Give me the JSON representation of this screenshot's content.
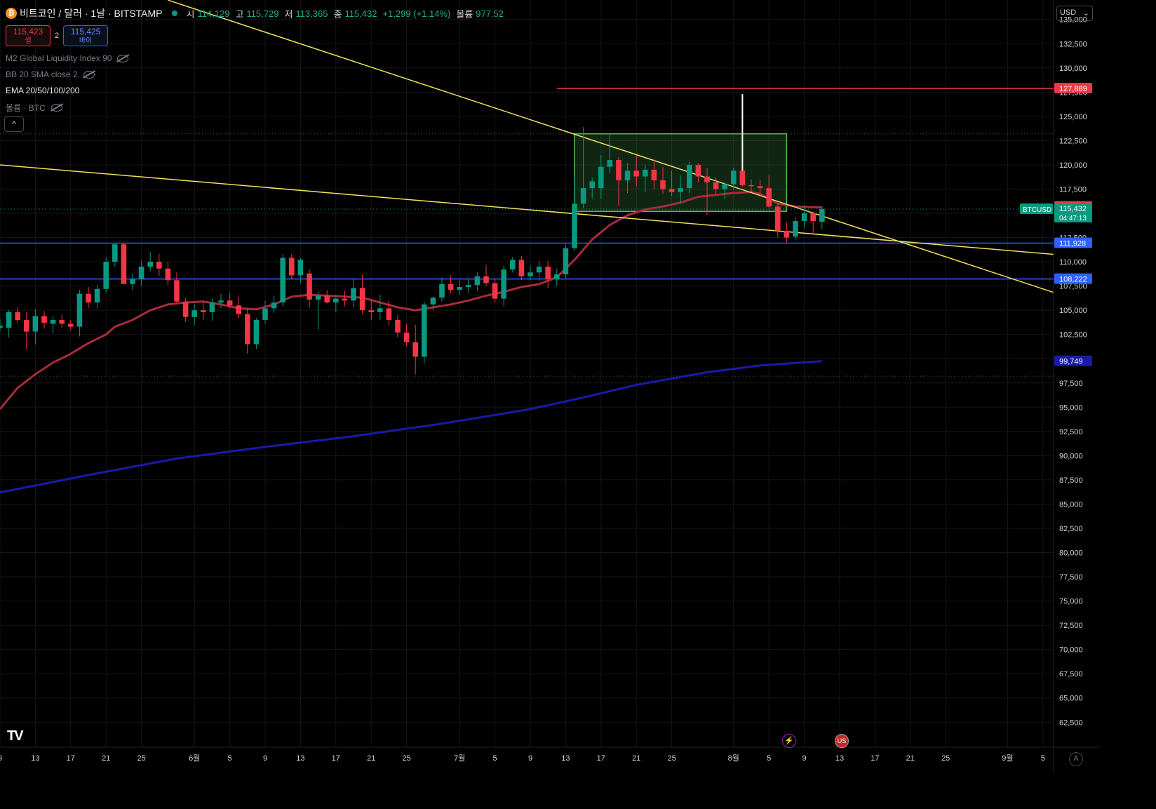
{
  "header": {
    "symbol_icon": "bitcoin-icon",
    "title": "비트코인 / 달러 · 1날 · BITSTAMP",
    "open_label": "시",
    "open": "114,129",
    "high_label": "고",
    "high": "115,729",
    "low_label": "저",
    "low": "113,365",
    "close_label": "종",
    "close": "115,432",
    "change": "+1,299 (+1.14%)",
    "volume_label": "볼륨",
    "volume": "977.52"
  },
  "trade": {
    "sell_price": "115,423",
    "sell_label": "셀",
    "spread": "2",
    "buy_price": "115,425",
    "buy_label": "바이"
  },
  "indicators": [
    {
      "label": "M2 Global Liquidity Index 90",
      "hidden": true
    },
    {
      "label": "BB 20 SMA close 2",
      "hidden": true
    },
    {
      "label": "EMA 20/50/100/200",
      "hidden": false
    },
    {
      "label": "볼륨 · BTC",
      "hidden": true
    }
  ],
  "currency": "USD",
  "collapse_glyph": "^",
  "logo_text": "TV",
  "events": [
    {
      "icon": "lightning-icon",
      "glyph": "⚡"
    },
    {
      "icon": "us-flag-icon",
      "glyph": "US"
    }
  ],
  "auto_label": "A",
  "colors": {
    "bg": "#000000",
    "up": "#089981",
    "down": "#f23645",
    "ema20": "#a82b3a",
    "ema200": "#1a1aa8",
    "trend": "#f2e05c",
    "support": "#2962ff",
    "resistance": "#f23645",
    "range_box": "#5bb85b"
  },
  "chart_data": {
    "type": "candlestick",
    "y_range": [
      61000,
      136500
    ],
    "y_ticks": [
      62500,
      65000,
      67500,
      70000,
      72500,
      75000,
      77500,
      80000,
      82500,
      85000,
      87500,
      90000,
      92500,
      95000,
      97500,
      100000,
      102500,
      105000,
      107500,
      110000,
      112500,
      115000,
      117500,
      120000,
      122500,
      125000,
      127500,
      130000,
      132500,
      135000
    ],
    "x_ticks": [
      {
        "day": 0,
        "label": "9"
      },
      {
        "day": 4,
        "label": "13"
      },
      {
        "day": 8,
        "label": "17"
      },
      {
        "day": 12,
        "label": "21"
      },
      {
        "day": 16,
        "label": "25"
      },
      {
        "day": 22,
        "label": "6월"
      },
      {
        "day": 26,
        "label": "5"
      },
      {
        "day": 30,
        "label": "9"
      },
      {
        "day": 34,
        "label": "13"
      },
      {
        "day": 38,
        "label": "17"
      },
      {
        "day": 42,
        "label": "21"
      },
      {
        "day": 46,
        "label": "25"
      },
      {
        "day": 52,
        "label": "7월"
      },
      {
        "day": 56,
        "label": "5"
      },
      {
        "day": 60,
        "label": "9"
      },
      {
        "day": 64,
        "label": "13"
      },
      {
        "day": 68,
        "label": "17"
      },
      {
        "day": 72,
        "label": "21"
      },
      {
        "day": 76,
        "label": "25"
      },
      {
        "day": 83,
        "label": "8월"
      },
      {
        "day": 87,
        "label": "5"
      },
      {
        "day": 91,
        "label": "9"
      },
      {
        "day": 95,
        "label": "13"
      },
      {
        "day": 99,
        "label": "17"
      },
      {
        "day": 103,
        "label": "21"
      },
      {
        "day": 107,
        "label": "25"
      },
      {
        "day": 114,
        "label": "9월"
      },
      {
        "day": 118,
        "label": "5"
      }
    ],
    "candles": [
      {
        "day": 0,
        "o": 103200,
        "h": 104100,
        "l": 102800,
        "c": 103400
      },
      {
        "day": 1,
        "o": 103200,
        "h": 105000,
        "l": 102200,
        "c": 104800
      },
      {
        "day": 2,
        "o": 104800,
        "h": 105300,
        "l": 103700,
        "c": 104000
      },
      {
        "day": 3,
        "o": 104000,
        "h": 104800,
        "l": 101000,
        "c": 102800
      },
      {
        "day": 4,
        "o": 102800,
        "h": 105100,
        "l": 101500,
        "c": 104400
      },
      {
        "day": 5,
        "o": 104400,
        "h": 104900,
        "l": 103100,
        "c": 103700
      },
      {
        "day": 6,
        "o": 103600,
        "h": 104400,
        "l": 102600,
        "c": 104000
      },
      {
        "day": 7,
        "o": 104000,
        "h": 104500,
        "l": 103200,
        "c": 103600
      },
      {
        "day": 8,
        "o": 103600,
        "h": 104000,
        "l": 102900,
        "c": 103300
      },
      {
        "day": 9,
        "o": 103300,
        "h": 107100,
        "l": 102300,
        "c": 106700
      },
      {
        "day": 10,
        "o": 106700,
        "h": 107400,
        "l": 105200,
        "c": 105800
      },
      {
        "day": 11,
        "o": 105800,
        "h": 107600,
        "l": 105200,
        "c": 107200
      },
      {
        "day": 12,
        "o": 107200,
        "h": 110500,
        "l": 106800,
        "c": 110000
      },
      {
        "day": 13,
        "o": 110000,
        "h": 112000,
        "l": 109500,
        "c": 111800
      },
      {
        "day": 14,
        "o": 111800,
        "h": 112000,
        "l": 108000,
        "c": 107700
      },
      {
        "day": 15,
        "o": 107700,
        "h": 108800,
        "l": 107100,
        "c": 108200
      },
      {
        "day": 16,
        "o": 108200,
        "h": 110100,
        "l": 107500,
        "c": 109500
      },
      {
        "day": 17,
        "o": 109500,
        "h": 111000,
        "l": 109000,
        "c": 110000
      },
      {
        "day": 18,
        "o": 110000,
        "h": 110800,
        "l": 108500,
        "c": 109300
      },
      {
        "day": 19,
        "o": 109300,
        "h": 110000,
        "l": 107600,
        "c": 108100
      },
      {
        "day": 20,
        "o": 108100,
        "h": 108900,
        "l": 105800,
        "c": 105900
      },
      {
        "day": 21,
        "o": 105900,
        "h": 106300,
        "l": 103800,
        "c": 104300
      },
      {
        "day": 22,
        "o": 104300,
        "h": 105700,
        "l": 103500,
        "c": 105000
      },
      {
        "day": 23,
        "o": 105000,
        "h": 105900,
        "l": 104000,
        "c": 104800
      },
      {
        "day": 24,
        "o": 104800,
        "h": 106200,
        "l": 103900,
        "c": 105800
      },
      {
        "day": 25,
        "o": 105800,
        "h": 106700,
        "l": 105200,
        "c": 106000
      },
      {
        "day": 26,
        "o": 106000,
        "h": 106800,
        "l": 105200,
        "c": 105500
      },
      {
        "day": 27,
        "o": 105500,
        "h": 106400,
        "l": 104200,
        "c": 104600
      },
      {
        "day": 28,
        "o": 104600,
        "h": 105200,
        "l": 100500,
        "c": 101500
      },
      {
        "day": 29,
        "o": 101500,
        "h": 104200,
        "l": 101000,
        "c": 104000
      },
      {
        "day": 30,
        "o": 104000,
        "h": 106000,
        "l": 103600,
        "c": 105200
      },
      {
        "day": 31,
        "o": 105200,
        "h": 106500,
        "l": 104700,
        "c": 105800
      },
      {
        "day": 32,
        "o": 105800,
        "h": 110800,
        "l": 105400,
        "c": 110400
      },
      {
        "day": 33,
        "o": 110400,
        "h": 110800,
        "l": 108200,
        "c": 108600
      },
      {
        "day": 34,
        "o": 108600,
        "h": 110400,
        "l": 107800,
        "c": 110200
      },
      {
        "day": 35,
        "o": 108800,
        "h": 109200,
        "l": 105200,
        "c": 106100
      },
      {
        "day": 36,
        "o": 106100,
        "h": 106900,
        "l": 103000,
        "c": 106500
      },
      {
        "day": 37,
        "o": 106500,
        "h": 107100,
        "l": 105700,
        "c": 105800
      },
      {
        "day": 38,
        "o": 105800,
        "h": 106600,
        "l": 104800,
        "c": 106200
      },
      {
        "day": 39,
        "o": 106200,
        "h": 107000,
        "l": 105400,
        "c": 106000
      },
      {
        "day": 40,
        "o": 106000,
        "h": 108200,
        "l": 105300,
        "c": 107300
      },
      {
        "day": 41,
        "o": 107300,
        "h": 108700,
        "l": 104600,
        "c": 105000
      },
      {
        "day": 42,
        "o": 105000,
        "h": 106100,
        "l": 104000,
        "c": 104800
      },
      {
        "day": 43,
        "o": 104800,
        "h": 106600,
        "l": 104000,
        "c": 105200
      },
      {
        "day": 44,
        "o": 105200,
        "h": 106000,
        "l": 103400,
        "c": 104000
      },
      {
        "day": 45,
        "o": 104000,
        "h": 104500,
        "l": 102200,
        "c": 102700
      },
      {
        "day": 46,
        "o": 102700,
        "h": 103600,
        "l": 101300,
        "c": 101700
      },
      {
        "day": 47,
        "o": 101700,
        "h": 103500,
        "l": 98400,
        "c": 100200
      },
      {
        "day": 48,
        "o": 100200,
        "h": 105900,
        "l": 99500,
        "c": 105600
      },
      {
        "day": 49,
        "o": 105600,
        "h": 106400,
        "l": 105000,
        "c": 106300
      },
      {
        "day": 50,
        "o": 106300,
        "h": 108400,
        "l": 105900,
        "c": 107700
      },
      {
        "day": 51,
        "o": 107700,
        "h": 108600,
        "l": 106800,
        "c": 107100
      },
      {
        "day": 52,
        "o": 107100,
        "h": 108100,
        "l": 106600,
        "c": 107400
      },
      {
        "day": 53,
        "o": 107400,
        "h": 108200,
        "l": 106800,
        "c": 107600
      },
      {
        "day": 54,
        "o": 107600,
        "h": 108900,
        "l": 107000,
        "c": 108500
      },
      {
        "day": 55,
        "o": 108500,
        "h": 109700,
        "l": 107500,
        "c": 107800
      },
      {
        "day": 56,
        "o": 107800,
        "h": 108200,
        "l": 105800,
        "c": 106200
      },
      {
        "day": 57,
        "o": 106200,
        "h": 109600,
        "l": 105400,
        "c": 109200
      },
      {
        "day": 58,
        "o": 109200,
        "h": 110500,
        "l": 108900,
        "c": 110200
      },
      {
        "day": 59,
        "o": 110200,
        "h": 110600,
        "l": 108100,
        "c": 108500
      },
      {
        "day": 60,
        "o": 108500,
        "h": 109600,
        "l": 108100,
        "c": 108900
      },
      {
        "day": 61,
        "o": 108900,
        "h": 110100,
        "l": 108000,
        "c": 109500
      },
      {
        "day": 62,
        "o": 109500,
        "h": 110100,
        "l": 107300,
        "c": 108200
      },
      {
        "day": 63,
        "o": 108200,
        "h": 109300,
        "l": 107500,
        "c": 108700
      },
      {
        "day": 64,
        "o": 108700,
        "h": 111800,
        "l": 108300,
        "c": 111400
      },
      {
        "day": 65,
        "o": 111400,
        "h": 118800,
        "l": 111100,
        "c": 116000
      },
      {
        "day": 66,
        "o": 116000,
        "h": 123900,
        "l": 115500,
        "c": 117600
      },
      {
        "day": 67,
        "o": 117600,
        "h": 118700,
        "l": 116500,
        "c": 118300
      },
      {
        "day": 68,
        "o": 117600,
        "h": 121000,
        "l": 116500,
        "c": 119800
      },
      {
        "day": 69,
        "o": 119800,
        "h": 123200,
        "l": 119100,
        "c": 120500
      },
      {
        "day": 70,
        "o": 120500,
        "h": 120800,
        "l": 115800,
        "c": 118400
      },
      {
        "day": 71,
        "o": 118400,
        "h": 120200,
        "l": 117100,
        "c": 119400
      },
      {
        "day": 72,
        "o": 119400,
        "h": 121000,
        "l": 117800,
        "c": 118800
      },
      {
        "day": 73,
        "o": 118800,
        "h": 120000,
        "l": 117200,
        "c": 119500
      },
      {
        "day": 74,
        "o": 119500,
        "h": 120600,
        "l": 117500,
        "c": 118400
      },
      {
        "day": 75,
        "o": 118400,
        "h": 119800,
        "l": 117000,
        "c": 117500
      },
      {
        "day": 76,
        "o": 117500,
        "h": 119400,
        "l": 116800,
        "c": 117200
      },
      {
        "day": 77,
        "o": 117200,
        "h": 118900,
        "l": 116000,
        "c": 117600
      },
      {
        "day": 78,
        "o": 117600,
        "h": 120300,
        "l": 117000,
        "c": 120000
      },
      {
        "day": 79,
        "o": 120000,
        "h": 120200,
        "l": 118200,
        "c": 118800
      },
      {
        "day": 80,
        "o": 118800,
        "h": 119700,
        "l": 114800,
        "c": 118200
      },
      {
        "day": 81,
        "o": 118200,
        "h": 118700,
        "l": 117000,
        "c": 117500
      },
      {
        "day": 82,
        "o": 117500,
        "h": 118200,
        "l": 116500,
        "c": 118000
      },
      {
        "day": 83,
        "o": 118000,
        "h": 119700,
        "l": 117400,
        "c": 119400
      },
      {
        "day": 84,
        "o": 119400,
        "h": 119600,
        "l": 117800,
        "c": 117900
      },
      {
        "day": 85,
        "o": 117900,
        "h": 118500,
        "l": 117200,
        "c": 117800
      },
      {
        "day": 86,
        "o": 117800,
        "h": 118400,
        "l": 116800,
        "c": 117600
      },
      {
        "day": 87,
        "o": 117600,
        "h": 118900,
        "l": 115500,
        "c": 115700
      },
      {
        "day": 88,
        "o": 115700,
        "h": 116000,
        "l": 112500,
        "c": 113200
      },
      {
        "day": 89,
        "o": 113200,
        "h": 114100,
        "l": 112000,
        "c": 112500
      },
      {
        "day": 90,
        "o": 112600,
        "h": 114600,
        "l": 112300,
        "c": 114200
      },
      {
        "day": 91,
        "o": 114200,
        "h": 115800,
        "l": 113500,
        "c": 115000
      },
      {
        "day": 92,
        "o": 115000,
        "h": 115200,
        "l": 112900,
        "c": 114200
      },
      {
        "day": 93,
        "o": 114129,
        "h": 115729,
        "l": 113365,
        "c": 115432
      }
    ],
    "ema20": [
      [
        0,
        94800
      ],
      [
        2,
        97000
      ],
      [
        4,
        98400
      ],
      [
        6,
        99600
      ],
      [
        8,
        100500
      ],
      [
        10,
        101600
      ],
      [
        12,
        102500
      ],
      [
        13,
        103300
      ],
      [
        15,
        104000
      ],
      [
        17,
        105000
      ],
      [
        19,
        105600
      ],
      [
        21,
        105800
      ],
      [
        23,
        105900
      ],
      [
        25,
        105600
      ],
      [
        27,
        105200
      ],
      [
        29,
        105100
      ],
      [
        31,
        105600
      ],
      [
        33,
        106400
      ],
      [
        35,
        106600
      ],
      [
        37,
        106500
      ],
      [
        39,
        106400
      ],
      [
        41,
        106300
      ],
      [
        43,
        105800
      ],
      [
        45,
        105300
      ],
      [
        47,
        105000
      ],
      [
        49,
        105300
      ],
      [
        51,
        105600
      ],
      [
        53,
        106000
      ],
      [
        55,
        106500
      ],
      [
        57,
        106900
      ],
      [
        59,
        107400
      ],
      [
        61,
        107700
      ],
      [
        63,
        108400
      ],
      [
        65,
        110200
      ],
      [
        67,
        112300
      ],
      [
        69,
        113800
      ],
      [
        71,
        114800
      ],
      [
        73,
        115400
      ],
      [
        75,
        115700
      ],
      [
        77,
        116100
      ],
      [
        79,
        116700
      ],
      [
        81,
        116900
      ],
      [
        83,
        117100
      ],
      [
        85,
        117200
      ],
      [
        86,
        117000
      ],
      [
        88,
        116000
      ],
      [
        90,
        115700
      ],
      [
        93,
        115600
      ]
    ],
    "ema200": [
      [
        0,
        86200
      ],
      [
        10,
        88000
      ],
      [
        20,
        89700
      ],
      [
        30,
        90900
      ],
      [
        40,
        92000
      ],
      [
        50,
        93300
      ],
      [
        60,
        94800
      ],
      [
        66,
        96000
      ],
      [
        72,
        97300
      ],
      [
        80,
        98600
      ],
      [
        86,
        99300
      ],
      [
        93,
        99749
      ]
    ],
    "trendlines": [
      {
        "from": [
          19,
          137000
        ],
        "to": [
          120,
          106600
        ]
      },
      {
        "from": [
          0,
          120000
        ],
        "to": [
          120,
          110700
        ]
      }
    ],
    "hlines": [
      {
        "value": 111928,
        "label": "111,928",
        "color": "#2962ff",
        "from_day": 0
      },
      {
        "value": 108222,
        "label": "108,222",
        "color": "#2962ff",
        "from_day": 0
      },
      {
        "value": 127889,
        "label": "127,889",
        "color": "#f23645",
        "from_day": 63
      }
    ],
    "range_box": {
      "day_from": 65,
      "day_to": 89,
      "top": 123200,
      "bottom": 115200
    },
    "vmarker": {
      "day": 84,
      "from": 119400,
      "to": 127300
    },
    "price_labels": [
      {
        "value": 115673,
        "label": "115,673",
        "color": "#f23645"
      },
      {
        "value": 99749,
        "label": "99,749",
        "color": "#1a1aa8"
      }
    ],
    "last_price": {
      "value": 115432,
      "label": "115,432",
      "countdown": "04:47:13",
      "symbol": "BTCUSD"
    }
  }
}
